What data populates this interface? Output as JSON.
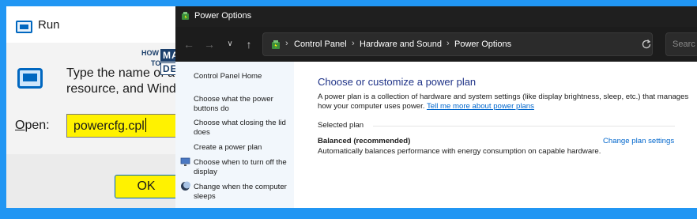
{
  "run_dialog": {
    "title": "Run",
    "description": "Type the name of a program, folder, document, or Internet resource, and Windows will open it for you.",
    "description_visible": "Type the name of a program,\nresource, and Windo",
    "open_label_accel": "O",
    "open_label_rest": "pen:",
    "input_value": "powercfg.cpl",
    "ok_label": "OK",
    "highlight_color": "#fff200"
  },
  "logo": {
    "how": "HOW",
    "to": "TO",
    "manage": "MANAGE",
    "devices": "DEVICES"
  },
  "power_options": {
    "window_title": "Power Options",
    "breadcrumbs": [
      "Control Panel",
      "Hardware and Sound",
      "Power Options"
    ],
    "search_placeholder": "Searc",
    "left_nav": {
      "home": "Control Panel Home",
      "items": [
        "Choose what the power buttons do",
        "Choose what closing the lid does",
        "Create a power plan",
        "Choose when to turn off the display",
        "Change when the computer sleeps"
      ]
    },
    "heading": "Choose or customize a power plan",
    "description": "A power plan is a collection of hardware and system settings (like display brightness, sleep, etc.) that manages how your computer uses power.",
    "description_link": "Tell me more about power plans",
    "selected_plan_label": "Selected plan",
    "plan": {
      "name": "Balanced (recommended)",
      "change_link": "Change plan settings",
      "description": "Automatically balances performance with energy consumption on capable hardware."
    }
  },
  "colors": {
    "background": "#2196f3",
    "heading_blue": "#1e3287",
    "link_blue": "#0066cc",
    "titlebar_dark": "#1f1f1f"
  }
}
